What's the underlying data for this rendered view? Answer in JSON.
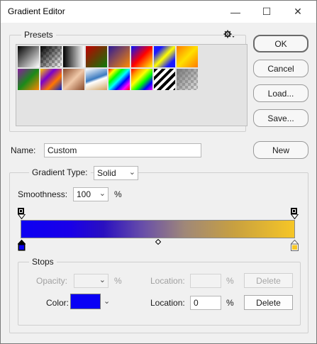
{
  "window": {
    "title": "Gradient Editor",
    "minimize_glyph": "—",
    "maximize_glyph": "☐",
    "close_glyph": "✕"
  },
  "presets": {
    "label": "Presets",
    "menu_icon": "gear-icon",
    "swatches": [
      {
        "name": "foreground-to-background",
        "css": "linear-gradient(135deg,#000 0%,#fff 100%)"
      },
      {
        "name": "foreground-to-transparent",
        "css": "linear-gradient(135deg,#000 0%,rgba(0,0,0,0) 100%)"
      },
      {
        "name": "black-white",
        "css": "linear-gradient(90deg,#000,#fff)"
      },
      {
        "name": "red-green",
        "css": "linear-gradient(135deg,#c00000,#0a7a0a)"
      },
      {
        "name": "violet-orange",
        "css": "linear-gradient(135deg,#2a1a9a,#ff8a00)"
      },
      {
        "name": "blue-red-yellow",
        "css": "linear-gradient(135deg,#0014ff,#ff0000 50%,#ffff00)"
      },
      {
        "name": "blue-yellow-blue",
        "css": "linear-gradient(135deg,#1a1aff 20%,#ffff00 50%,#1a1aff 80%)"
      },
      {
        "name": "orange-yellow-orange",
        "css": "linear-gradient(135deg,#ff7a00,#ffe000 50%,#ff7a00)"
      },
      {
        "name": "violet-green-orange",
        "css": "linear-gradient(135deg,#8a1aa0,#1a8a1a 50%,#ff8800)"
      },
      {
        "name": "yellow-violet-orange-blue",
        "css": "linear-gradient(135deg,#ffcc00,#7a00cc 35%,#ff7700 65%,#0022cc)"
      },
      {
        "name": "copper",
        "css": "linear-gradient(135deg,#8a4a2a,#f0c8a8 50%,#8a4a2a)"
      },
      {
        "name": "chrome",
        "css": "linear-gradient(160deg,#fff 0%,#3a7ac0 45%,#fff 55%,#d0a060 100%)"
      },
      {
        "name": "spectrum",
        "css": "linear-gradient(135deg,#ff0000,#ffff00,#00ff00,#00ffff,#0000ff,#ff00ff,#ff0000)"
      },
      {
        "name": "transparent-rainbow",
        "css": "linear-gradient(135deg,#ff0000,#ff9900,#ffff00,#00ff00,#0000ff,#ff00ff)"
      },
      {
        "name": "transparent-stripes",
        "css": "repeating-linear-gradient(135deg,#000 0 4px,#fff 4px 8px)"
      },
      {
        "name": "neutral-density",
        "css": "linear-gradient(135deg,#777,rgba(120,120,120,0.2))"
      }
    ]
  },
  "buttons": {
    "ok": "OK",
    "cancel": "Cancel",
    "load": "Load...",
    "save": "Save...",
    "new": "New"
  },
  "name_field": {
    "label": "Name:",
    "value": "Custom"
  },
  "gradient_type": {
    "label": "Gradient Type:",
    "value": "Solid"
  },
  "smoothness": {
    "label": "Smoothness:",
    "value": "100",
    "unit": "%"
  },
  "gradient_bar": {
    "css": "linear-gradient(90deg,#0c00f2 0%,#1a00e8 18%,#2a10c0 30%,#6a50a8 45%,#a08878 60%,#c8a040 78%,#f6c626 100%)"
  },
  "stops": {
    "label": "Stops",
    "opacity_label": "Opacity:",
    "opacity_value": "",
    "opacity_unit": "%",
    "opacity_location_label": "Location:",
    "opacity_location_value": "",
    "opacity_location_unit": "%",
    "delete_label": "Delete",
    "color_label": "Color:",
    "color_value": "#0a00f5",
    "color_location_label": "Location:",
    "color_location_value": "0",
    "color_location_unit": "%",
    "left_color": "#0a00f5",
    "right_color": "#f6c626"
  }
}
